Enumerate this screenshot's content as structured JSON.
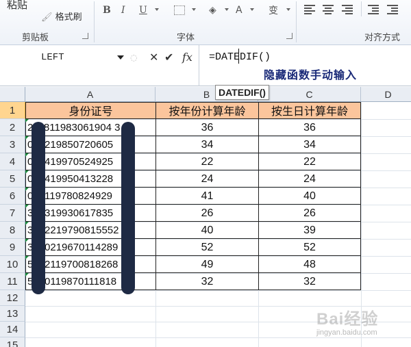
{
  "ribbon": {
    "paste_label": "粘贴",
    "format_painter_label": "格式刷",
    "groups": [
      "剪贴板",
      "字体",
      "对齐方式"
    ],
    "font_buttons": [
      "B",
      "I",
      "U"
    ],
    "font_color_symbol": "A",
    "wen_symbol": "变"
  },
  "formula_bar": {
    "name_box": "LEFT",
    "cancel_symbol": "✕",
    "enter_symbol": "✔",
    "fx_symbol": "fx",
    "formula": "=DATEDIF()",
    "annotation": "隐藏函数手动输入",
    "tooltip": "DATEDIF()"
  },
  "columns": [
    "A",
    "B",
    "C",
    "D"
  ],
  "rows": [
    "1",
    "2",
    "3",
    "4",
    "5",
    "6",
    "7",
    "8",
    "9",
    "10",
    "11",
    "12",
    "13",
    "14",
    "15"
  ],
  "table": {
    "headers": [
      "身份证号",
      "按年份计算年龄",
      "按生日计算年龄"
    ],
    "rows": [
      {
        "id": "211811983061904 3",
        "by_year": "36",
        "by_birthday": "36"
      },
      {
        "id": "080219850720605",
        "by_year": "34",
        "by_birthday": "34"
      },
      {
        "id": "032419970524925",
        "by_year": "22",
        "by_birthday": "22"
      },
      {
        "id": "018419950413228",
        "by_year": "24",
        "by_birthday": "24"
      },
      {
        "id": "052119780824929",
        "by_year": "41",
        "by_birthday": "40"
      },
      {
        "id": "343319930617835",
        "by_year": "26",
        "by_birthday": "26"
      },
      {
        "id": "3102219790815552",
        "by_year": "40",
        "by_birthday": "39"
      },
      {
        "id": "3010219670114289",
        "by_year": "52",
        "by_birthday": "52"
      },
      {
        "id": "5012119700818268",
        "by_year": "49",
        "by_birthday": "48"
      },
      {
        "id": "5040119870111818",
        "by_year": "32",
        "by_birthday": "32"
      }
    ]
  },
  "watermark": {
    "logo": "Bai经验",
    "url": "jingyan.baidu.com"
  }
}
